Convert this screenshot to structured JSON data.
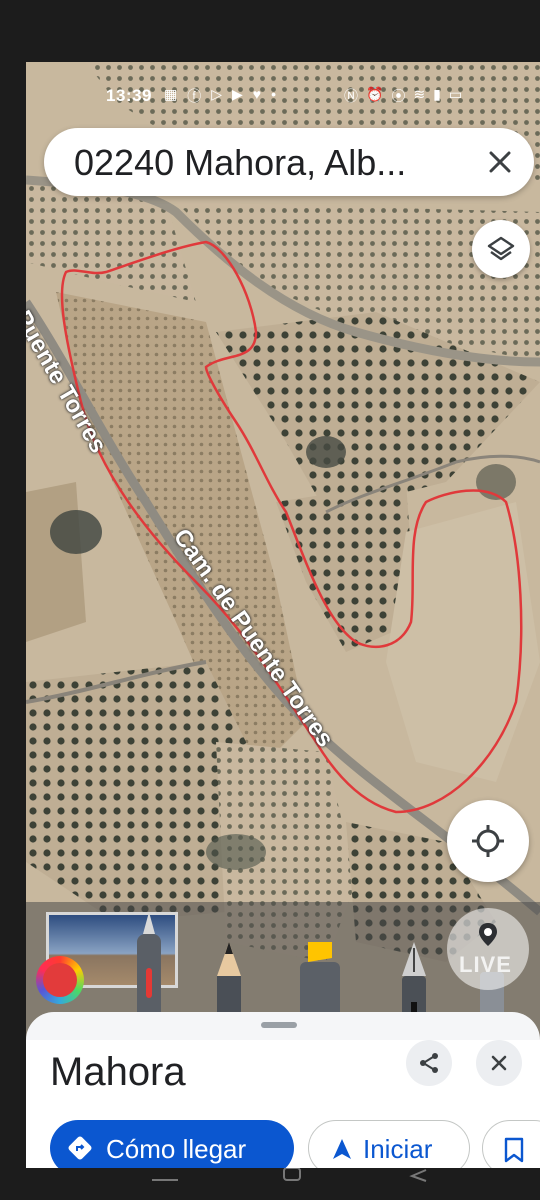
{
  "status_bar": {
    "time": "13:39",
    "left_icons": [
      "temu-icon",
      "facebook-icon",
      "play-icon",
      "youtube-icon",
      "health-icon",
      "dot-icon"
    ],
    "right_icons": [
      "nfc-icon",
      "alarm-icon",
      "location-icon",
      "wifi-icon",
      "signal-icon",
      "battery-icon"
    ]
  },
  "search": {
    "query": "02240 Mahora, Alb..."
  },
  "map": {
    "street_labels": [
      "Cam. de Puente Torres",
      "Puente Torres"
    ],
    "annotation_color": "#e0393b"
  },
  "live_view": {
    "label": "LIVE"
  },
  "place": {
    "title": "Mahora"
  },
  "actions": {
    "directions_label": "Cómo llegar",
    "start_label": "Iniciar"
  },
  "colors": {
    "primary": "#0b57d0",
    "sheet": "#ffffff"
  }
}
